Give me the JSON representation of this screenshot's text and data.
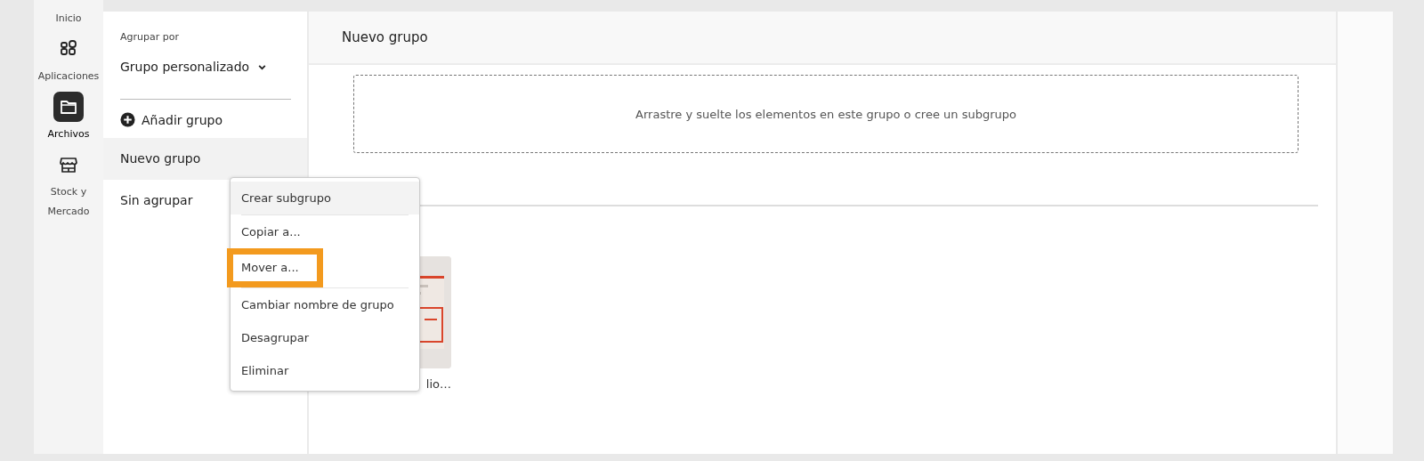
{
  "rail": [
    {
      "label": "Inicio",
      "selected": false
    },
    {
      "label": "Aplicaciones",
      "selected": false
    },
    {
      "label": "Archivos",
      "selected": true
    },
    {
      "label": "Stock y Mercado",
      "selected": false
    }
  ],
  "sidebar": {
    "group_by_label": "Agrupar por",
    "group_by_value": "Grupo personalizado",
    "add_group": "Añadir grupo",
    "groups": [
      {
        "label": "Nuevo grupo",
        "selected": true
      },
      {
        "label": "Sin agrupar",
        "selected": false
      }
    ]
  },
  "main": {
    "title": "Nuevo grupo",
    "drop_hint": "Arrastre y suelte los elementos en este grupo o cree un subgrupo",
    "cards": [
      {
        "kind": "picture",
        "label": "lio…"
      }
    ]
  },
  "context_menu": [
    {
      "items": [
        {
          "label": "Crear subgrupo",
          "selected": true,
          "highlighted": false
        }
      ]
    },
    {
      "items": [
        {
          "label": "Copiar a...",
          "selected": false,
          "highlighted": false
        },
        {
          "label": "Mover a...",
          "selected": false,
          "highlighted": true
        }
      ]
    },
    {
      "items": [
        {
          "label": "Cambiar nombre de grupo",
          "selected": false,
          "highlighted": false
        },
        {
          "label": "Desagrupar",
          "selected": false,
          "highlighted": false
        },
        {
          "label": "Eliminar",
          "selected": false,
          "highlighted": false
        }
      ]
    }
  ]
}
